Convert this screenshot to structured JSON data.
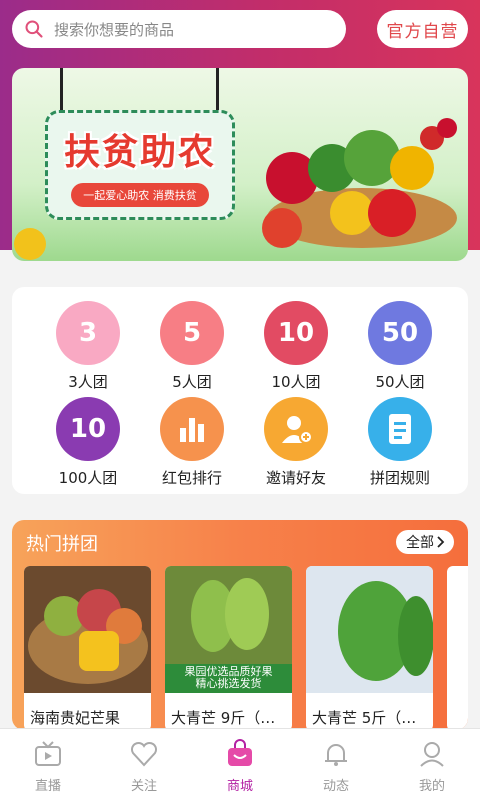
{
  "search": {
    "placeholder": "搜索你想要的商品",
    "icon": "search-icon"
  },
  "header": {
    "official_label": "官方自营"
  },
  "banner": {
    "title": "扶贫助农",
    "subtitle": "一起爱心助农 消费扶贫"
  },
  "groups": [
    {
      "label": "3人团",
      "badge": "3",
      "color": "#f9a9c3"
    },
    {
      "label": "5人团",
      "badge": "5",
      "color": "#f77e85"
    },
    {
      "label": "10人团",
      "badge": "10",
      "color": "#e24b63"
    },
    {
      "label": "50人团",
      "badge": "50",
      "color": "#6f79e0"
    },
    {
      "label": "100人团",
      "badge": "10",
      "color": "#8a3bb1"
    },
    {
      "label": "红包排行",
      "badge": "",
      "color": "#f6924d"
    },
    {
      "label": "邀请好友",
      "badge": "",
      "color": "#f7a832"
    },
    {
      "label": "拼团规则",
      "badge": "",
      "color": "#37b0ea"
    }
  ],
  "hot": {
    "title": "热门拼团",
    "all_label": "全部",
    "products": [
      {
        "name": "海南贵妃芒果"
      },
      {
        "name": "大青芒 9斤（…"
      },
      {
        "name": "大青芒 5斤（…"
      }
    ],
    "promo_line1": "果园优选品质好果",
    "promo_line2": "精心挑选发货"
  },
  "tabbar": [
    {
      "label": "直播",
      "icon": "tv-icon"
    },
    {
      "label": "关注",
      "icon": "heart-icon"
    },
    {
      "label": "商城",
      "icon": "shopping-bag-icon",
      "active": true
    },
    {
      "label": "动态",
      "icon": "bell-icon"
    },
    {
      "label": "我的",
      "icon": "user-icon"
    }
  ]
}
